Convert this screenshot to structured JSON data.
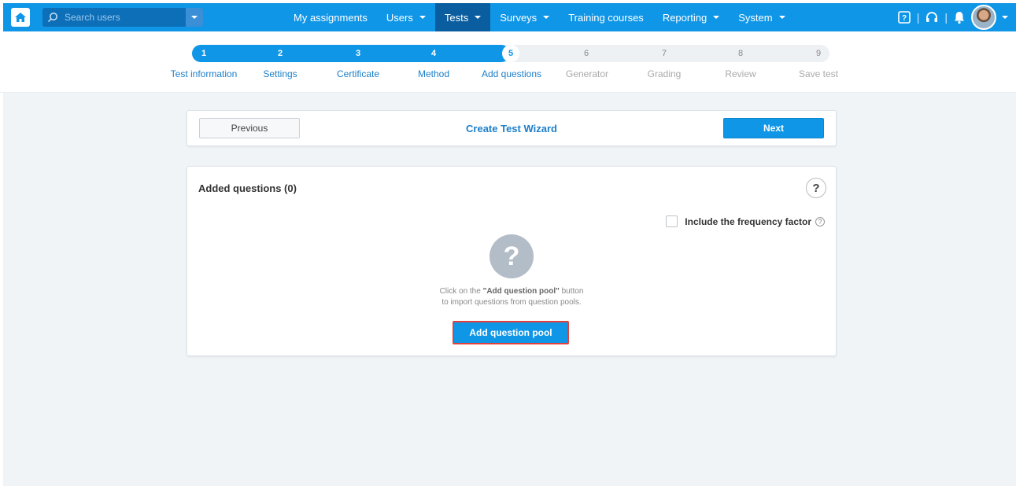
{
  "nav": {
    "search_placeholder": "Search users",
    "items": [
      {
        "label": "My assignments",
        "dropdown": false,
        "active": false
      },
      {
        "label": "Users",
        "dropdown": true,
        "active": false
      },
      {
        "label": "Tests",
        "dropdown": true,
        "active": true
      },
      {
        "label": "Surveys",
        "dropdown": true,
        "active": false
      },
      {
        "label": "Training courses",
        "dropdown": false,
        "active": false
      },
      {
        "label": "Reporting",
        "dropdown": true,
        "active": false
      },
      {
        "label": "System",
        "dropdown": true,
        "active": false
      }
    ],
    "separator": "|"
  },
  "wizard_steps": {
    "current": 5,
    "steps": [
      {
        "num": "1",
        "label": "Test information"
      },
      {
        "num": "2",
        "label": "Settings"
      },
      {
        "num": "3",
        "label": "Certificate"
      },
      {
        "num": "4",
        "label": "Method"
      },
      {
        "num": "5",
        "label": "Add questions"
      },
      {
        "num": "6",
        "label": "Generator"
      },
      {
        "num": "7",
        "label": "Grading"
      },
      {
        "num": "8",
        "label": "Review"
      },
      {
        "num": "9",
        "label": "Save test"
      }
    ]
  },
  "wizard_bar": {
    "previous_label": "Previous",
    "title": "Create Test Wizard",
    "next_label": "Next"
  },
  "panel": {
    "title": "Added questions (0)",
    "help_symbol": "?",
    "frequency_label": "Include the frequency factor",
    "frequency_checked": false,
    "empty_icon_symbol": "?",
    "empty_text_prefix": "Click on the ",
    "empty_text_bold": "\"Add question pool\"",
    "empty_text_suffix": " button",
    "empty_text_line2": "to import questions from question pools.",
    "add_button_label": "Add question pool"
  },
  "colors": {
    "primary": "#1096e7",
    "active_nav": "#0a5ea0",
    "highlight_border": "#e0413b",
    "content_bg": "#f1f4f7"
  }
}
